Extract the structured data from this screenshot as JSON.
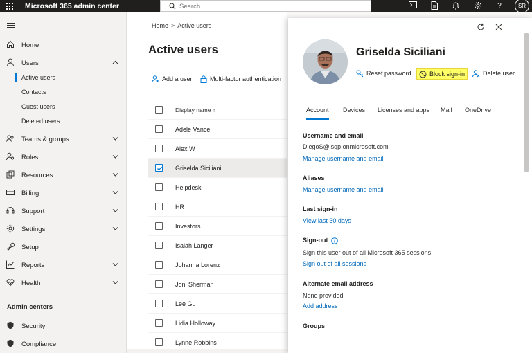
{
  "topbar": {
    "app_title": "Microsoft 365 admin center",
    "search_placeholder": "Search",
    "user_initials": "SR"
  },
  "nav": {
    "items": [
      {
        "id": "home",
        "label": "Home"
      },
      {
        "id": "users",
        "label": "Users"
      },
      {
        "id": "teams-groups",
        "label": "Teams & groups"
      },
      {
        "id": "roles",
        "label": "Roles"
      },
      {
        "id": "resources",
        "label": "Resources"
      },
      {
        "id": "billing",
        "label": "Billing"
      },
      {
        "id": "support",
        "label": "Support"
      },
      {
        "id": "settings",
        "label": "Settings"
      },
      {
        "id": "setup",
        "label": "Setup"
      },
      {
        "id": "reports",
        "label": "Reports"
      },
      {
        "id": "health",
        "label": "Health"
      }
    ],
    "users_sub": [
      "Active users",
      "Contacts",
      "Guest users",
      "Deleted users"
    ],
    "admin_centers_heading": "Admin centers",
    "admin_centers": [
      "Security",
      "Compliance"
    ]
  },
  "main": {
    "breadcrumb": [
      "Home",
      "Active users"
    ],
    "title": "Active users",
    "commands": {
      "add_user": "Add a user",
      "mfa": "Multi-factor authentication"
    },
    "column_header": "Display name ↑",
    "users": [
      "Adele Vance",
      "Alex W",
      "Griselda Siciliani",
      "Helpdesk",
      "HR",
      "Investors",
      "Isaiah Langer",
      "Johanna Lorenz",
      "Joni Sherman",
      "Lee Gu",
      "Lidia Holloway",
      "Lynne Robbins"
    ],
    "selected_user": "Griselda Siciliani"
  },
  "panel": {
    "user_name": "Griselda Siciliani",
    "actions": {
      "reset_password": "Reset password",
      "block_signin": "Block sign-in",
      "delete_user": "Delete user"
    },
    "tabs": [
      "Account",
      "Devices",
      "Licenses and apps",
      "Mail",
      "OneDrive"
    ],
    "active_tab": "Account",
    "sections": {
      "username_title": "Username and email",
      "username_value": "DiegoS@lsqp.onmicrosoft.com",
      "username_link": "Manage username and email",
      "aliases_title": "Aliases",
      "aliases_link": "Manage username and email",
      "last_signin_title": "Last sign-in",
      "last_signin_link": "View last 30 days",
      "signout_title": "Sign-out",
      "signout_text": "Sign this user out of all Microsoft 365 sessions.",
      "signout_link": "Sign out of all sessions",
      "alt_email_title": "Alternate email address",
      "alt_email_value": "None provided",
      "alt_email_link": "Add address",
      "groups_title": "Groups"
    }
  },
  "colors": {
    "accent": "#0078d4",
    "link": "#0067b8",
    "highlight": "#ffff66",
    "topbar": "#201f1e"
  }
}
